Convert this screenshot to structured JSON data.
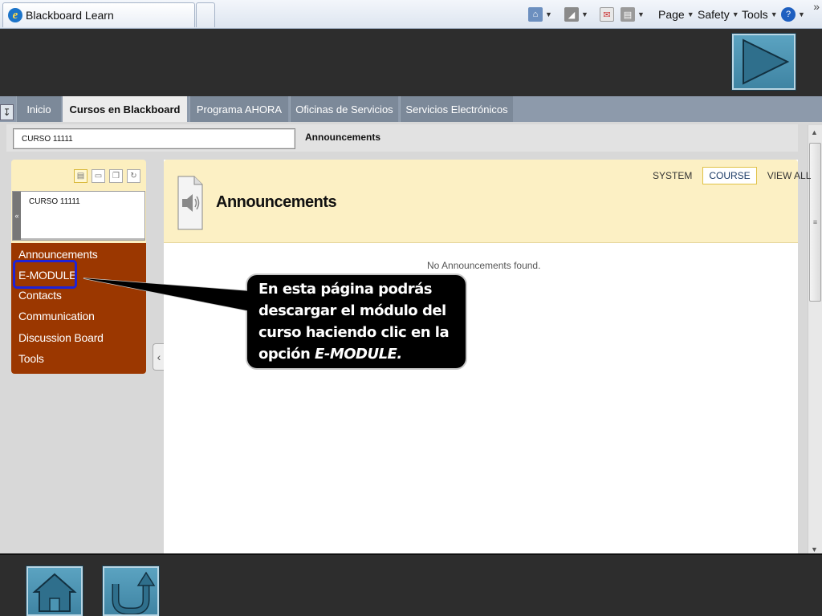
{
  "browser": {
    "tab_title": "Blackboard Learn",
    "commands": {
      "page": "Page",
      "safety": "Safety",
      "tools": "Tools"
    },
    "more": "»"
  },
  "nav": {
    "tabs": [
      {
        "label": "Inicio"
      },
      {
        "label": "Cursos en Blackboard"
      },
      {
        "label": "Programa AHORA"
      },
      {
        "label": "Oficinas de Servicios"
      },
      {
        "label": "Servicios Electrónicos"
      }
    ],
    "active_tab": "Cursos en Blackboard"
  },
  "breadcrumb": {
    "course": "CURSO 11111",
    "current": "Announcements"
  },
  "course_panel": {
    "course_name": "CURSO 11111",
    "menu": [
      {
        "label": "Announcements"
      },
      {
        "label": "E-MODULE"
      },
      {
        "label": "Contacts"
      },
      {
        "label": "Communication"
      },
      {
        "label": "Discussion Board"
      },
      {
        "label": "Tools"
      }
    ]
  },
  "content": {
    "title": "Announcements",
    "filters": [
      {
        "label": "SYSTEM"
      },
      {
        "label": "COURSE"
      },
      {
        "label": "VIEW ALL"
      }
    ],
    "selected_filter": "COURSE",
    "empty_message": "No Announcements found."
  },
  "callout": {
    "line1": "En esta página podrás",
    "line2": "descargar el módulo del",
    "line3": "curso haciendo clic en la",
    "line4_prefix": "opción ",
    "line4_emph": "E-MODULE."
  },
  "icons": {
    "home": "home-icon",
    "return": "return-icon",
    "next": "next-arrow-icon"
  },
  "colors": {
    "menu_bg": "#9b3700",
    "panel_header": "#fcf0c4",
    "nav_bar": "#8d9aab",
    "highlight_box": "#1e22d8",
    "slide_button": "#4b94b3"
  }
}
